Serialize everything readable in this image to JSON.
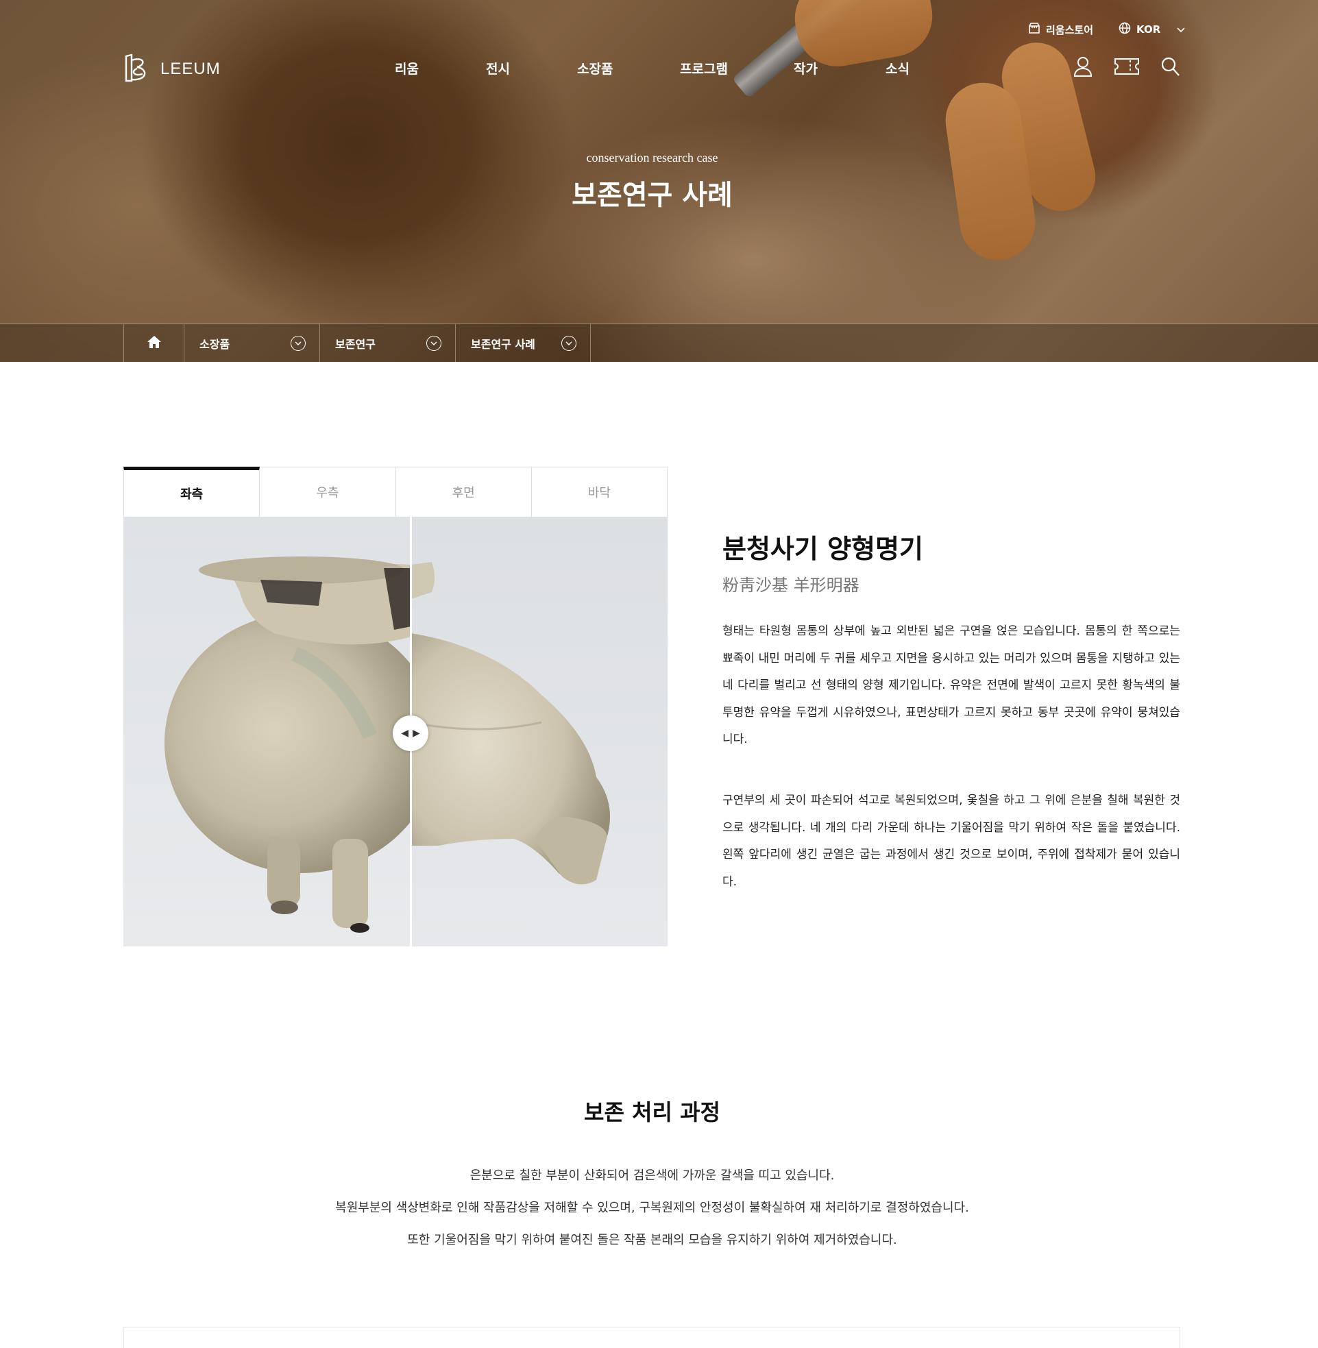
{
  "topbar": {
    "store_label": "리움스토어",
    "lang_label": "KOR"
  },
  "logo": {
    "text": "LEEUM"
  },
  "gnb": [
    "리움",
    "전시",
    "소장품",
    "프로그램",
    "작가",
    "소식"
  ],
  "hero": {
    "subtitle": "conservation research case",
    "title": "보존연구 사례"
  },
  "breadcrumb": [
    "소장품",
    "보존연구",
    "보존연구 사례"
  ],
  "tabs": [
    "좌측",
    "우측",
    "후면",
    "바닥"
  ],
  "object": {
    "title": "분청사기 양형명기",
    "hanja": "粉靑沙基 羊形明器",
    "desc1": "형태는 타원형 몸통의 상부에 높고 외반된 넓은 구연을 얹은 모습입니다. 몸통의 한 쪽으로는 뾰족이 내민 머리에 두 귀를 세우고 지면을 응시하고 있는 머리가 있으며 몸통을 지탱하고 있는 네 다리를 벌리고 선 형태의 양형 제기입니다. 유약은 전면에 발색이 고르지 못한 황녹색의 불투명한 유약을 두껍게 시유하였으나, 표면상태가 고르지 못하고 동부 곳곳에 유약이 뭉쳐있습니다.",
    "desc2": "구연부의 세 곳이 파손되어 석고로 복원되었으며, 옻칠을 하고 그 위에 은분을 칠해 복원한 것으로 생각됩니다. 네 개의 다리 가운데 하나는 기울어짐을 막기 위하여 작은 돌을 붙였습니다. 왼쪽 앞다리에 생긴 균열은 굽는 과정에서 생긴 것으로 보이며, 주위에 접착제가 묻어 있습니다."
  },
  "process": {
    "title": "보존 처리 과정",
    "lines": [
      "은분으로 칠한 부분이 산화되어 검은색에 가까운 갈색을 띠고 있습니다.",
      "복원부분의 색상변화로 인해 작품감상을 저해할 수 있으며, 구복원제의 안정성이 불확실하여 재 처리하기로 결정하였습니다.",
      "또한 기울어짐을 막기 위하여 붙여진 돌은 작품 본래의 모습을 유지하기 위하여 제거하였습니다."
    ]
  }
}
